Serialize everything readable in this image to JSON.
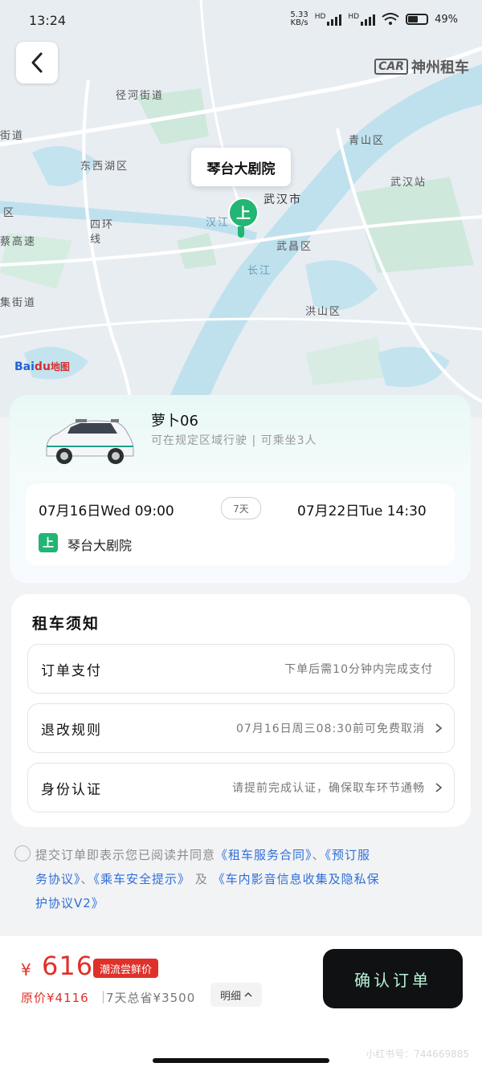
{
  "status": {
    "time": "13:24",
    "speed": "5.33",
    "speed_unit": "KB/s",
    "hd1": "HD",
    "hd2": "HD",
    "battery": "49%"
  },
  "brand": {
    "logo_car": "CAR",
    "name": "神州租车"
  },
  "map": {
    "poi": "琴台大剧院",
    "pin_label": "上",
    "districts": [
      "径河街道",
      "东西湖区",
      "青山区",
      "武汉市",
      "武汉站",
      "武昌区",
      "洪山区",
      "区",
      "蔡高速",
      "街道",
      "集街道",
      "四环线",
      "长江",
      "汉江",
      "高"
    ],
    "provider_prefix": "Bai",
    "provider_suffix": "地图"
  },
  "car": {
    "name": "萝卜06",
    "desc": "可在规定区域行驶 | 可乘坐3人",
    "start": "07月16日Wed 09:00",
    "days": "7天",
    "end": "07月22日Tue 14:30",
    "pickup_badge": "上",
    "pickup": "琴台大剧院"
  },
  "notice": {
    "title": "租车须知",
    "rows": [
      {
        "label": "订单支付",
        "value": "下单后需10分钟内完成支付"
      },
      {
        "label": "退改规则",
        "value": "07月16日周三08:30前可免费取消"
      },
      {
        "label": "身份认证",
        "value": "请提前完成认证，确保取车环节通畅"
      }
    ]
  },
  "agreement": {
    "prefix": "提交订单即表示您已阅读并同意",
    "link1": "《租车服务合同》",
    "sep1": "、",
    "link2a": "《预订服",
    "link2b": "务协议》",
    "sep2": "、",
    "link3": "《乘车安全提示》",
    "and": " 及 ",
    "link4a": "《车内影音信息收集及隐私保",
    "link4b": "护协议V2》"
  },
  "footer": {
    "currency": "¥",
    "price": "616",
    "promo": "潮流尝鲜价",
    "original": "原价¥4116",
    "separator": "|",
    "saved": "7天总省¥3500",
    "detail": "明细",
    "confirm": "确认订单",
    "watermark": "小红书号：744669885"
  }
}
